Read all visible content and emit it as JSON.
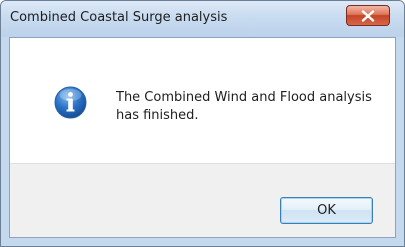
{
  "window": {
    "title": "Combined Coastal Surge analysis",
    "close_icon": "close-icon"
  },
  "message": {
    "icon": "info-icon",
    "text": "The Combined Wind and Flood analysis has finished."
  },
  "buttons": {
    "ok_label": "OK"
  },
  "colors": {
    "close_button": "#c34424",
    "info_icon": "#1f63b8",
    "title_bar": "#c8dbf0"
  }
}
